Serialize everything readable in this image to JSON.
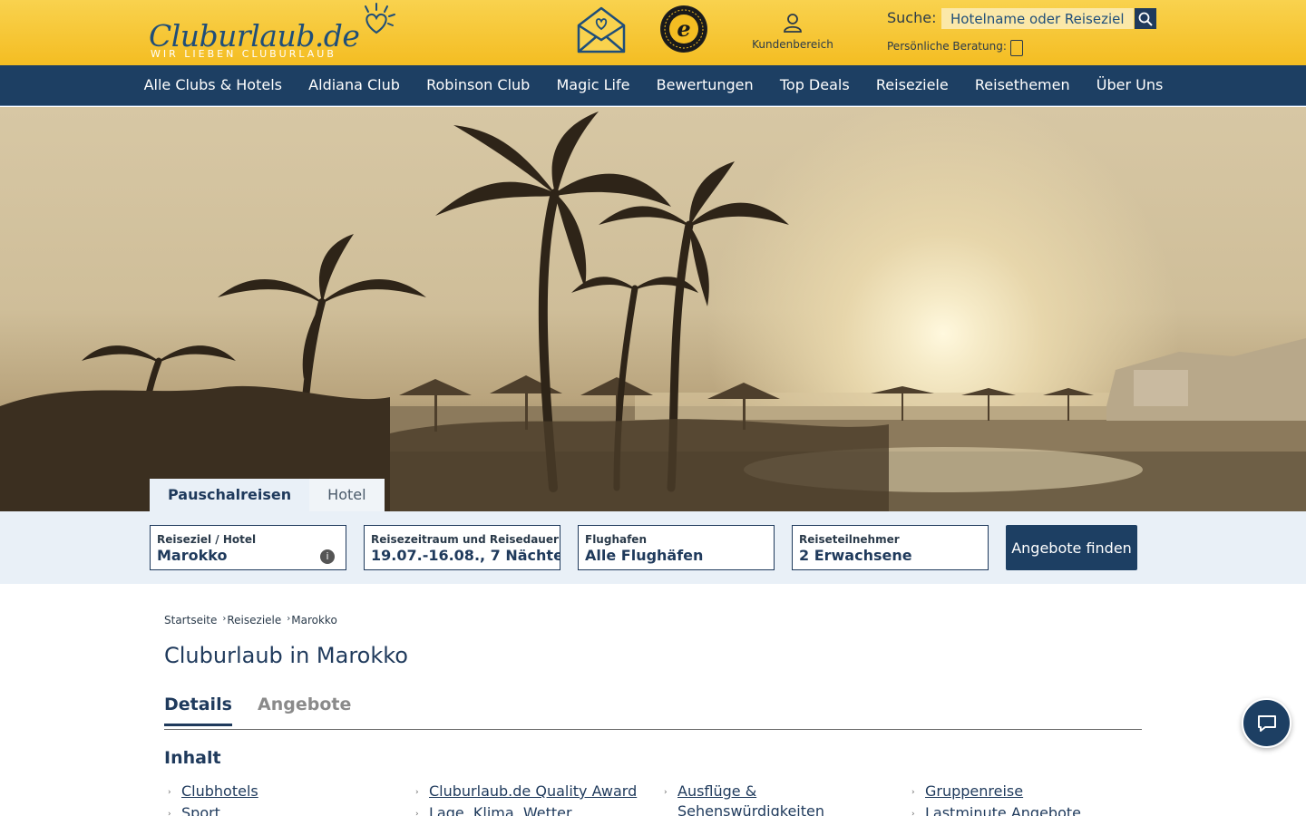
{
  "header": {
    "logo_text": "Cluburlaub.de",
    "logo_tagline": "WIR LIEBEN CLUBURLAUB",
    "newsletter_icon": "mail-heart-icon",
    "trusted_badge": "trusted-shops-badge",
    "account_label": "Kundenbereich",
    "search_label": "Suche:",
    "search_placeholder": "Hotelname oder Reiseziel",
    "consult_label": "Persönliche Beratung:",
    "accent_color": "#f5c12a",
    "navy_color": "#1d3f63"
  },
  "nav": {
    "items": [
      {
        "label": "Alle Clubs & Hotels"
      },
      {
        "label": "Aldiana Club"
      },
      {
        "label": "Robinson Club"
      },
      {
        "label": "Magic Life"
      },
      {
        "label": "Bewertungen"
      },
      {
        "label": "Top Deals"
      },
      {
        "label": "Reiseziele"
      },
      {
        "label": "Reisethemen"
      },
      {
        "label": "Über Uns"
      }
    ]
  },
  "booking": {
    "tabs": [
      {
        "label": "Pauschalreisen",
        "active": true
      },
      {
        "label": "Hotel",
        "active": false
      }
    ],
    "destination": {
      "label": "Reiseziel / Hotel",
      "value": "Marokko"
    },
    "dates": {
      "label": "Reisezeitraum und Reisedauer",
      "value": "19.07.-16.08., 7 Nächte"
    },
    "airport": {
      "label": "Flughafen",
      "value": "Alle Flughäfen"
    },
    "travelers": {
      "label": "Reiseteilnehmer",
      "value": "2 Erwachsene"
    },
    "submit_label": "Angebote finden"
  },
  "breadcrumb": {
    "items": [
      "Startseite",
      "Reiseziele",
      "Marokko"
    ]
  },
  "page": {
    "title": "Cluburlaub in Marokko",
    "tabs": [
      {
        "label": "Details",
        "active": true
      },
      {
        "label": "Angebote",
        "active": false
      }
    ],
    "toc_heading": "Inhalt",
    "toc_columns": [
      [
        "Clubhotels",
        "Sport"
      ],
      [
        "Cluburlaub.de Quality Award",
        "Lage, Klima, Wetter"
      ],
      [
        "Ausflüge & Sehenswürdigkeiten"
      ],
      [
        "Gruppenreise",
        "Lastminute Angebote"
      ]
    ]
  },
  "chat": {
    "icon": "chat-icon"
  }
}
